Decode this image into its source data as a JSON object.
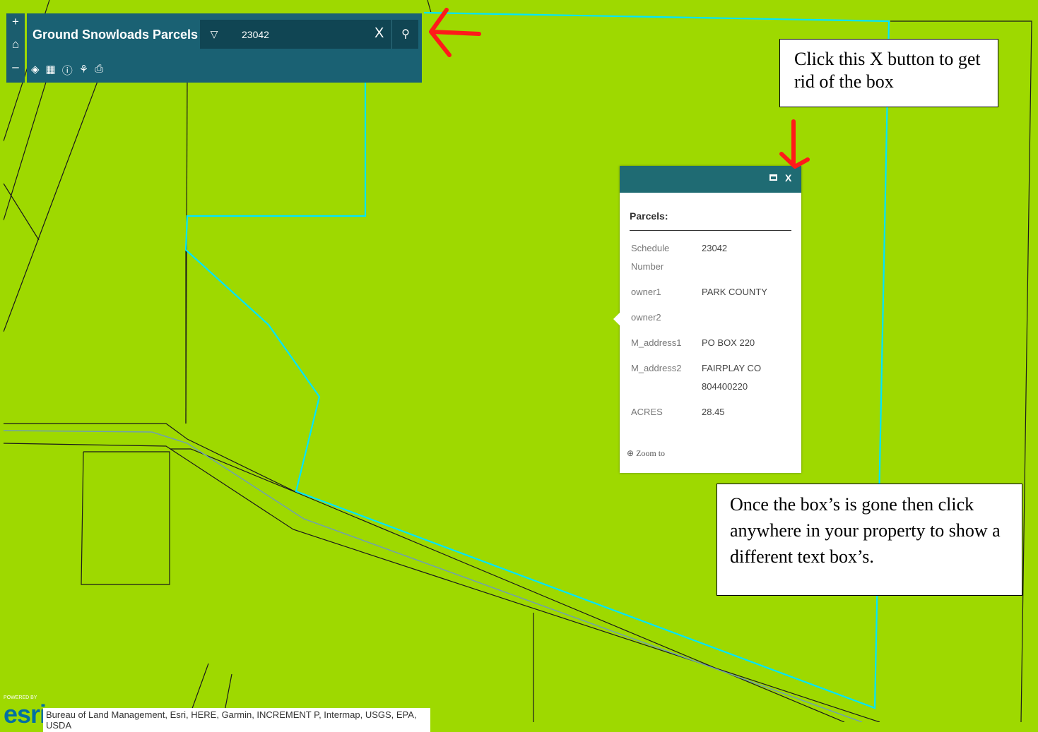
{
  "app": {
    "title": "Ground Snowloads Parcels",
    "search": {
      "value": "23042",
      "clear": "X",
      "search_icon": "search-icon",
      "dropdown_icon": "triangle-down-icon"
    },
    "toolbar_icons": [
      "layers-icon",
      "basemap-gallery-icon",
      "info-icon",
      "measure-icon",
      "print-icon"
    ],
    "zoom": {
      "in": "+",
      "home": "home-icon",
      "out": "–"
    },
    "colors": {
      "header": "#1a6173",
      "map": "#9ed900",
      "selected_outline": "#00e5ff"
    }
  },
  "popup": {
    "title": "Parcels:",
    "close": "X",
    "fields": [
      {
        "key": "Schedule Number",
        "value": "23042"
      },
      {
        "key": "owner1",
        "value": "PARK COUNTY"
      },
      {
        "key": "owner2",
        "value": ""
      },
      {
        "key": "M_address1",
        "value": "PO BOX 220"
      },
      {
        "key": "M_address2",
        "value": "FAIRPLAY CO 804400220"
      },
      {
        "key": "ACRES",
        "value": "28.45"
      }
    ],
    "zoom_to": "Zoom to"
  },
  "notes": {
    "note1": "Click this X button to get rid of the box",
    "note2": "Once the box’s is gone then click anywhere in your property to show a different text box’s."
  },
  "attribution": {
    "powered_by": "POWERED BY",
    "logo": "esri",
    "credits": "Bureau of Land Management, Esri, HERE, Garmin, INCREMENT P, Intermap, USGS, EPA, USDA"
  }
}
